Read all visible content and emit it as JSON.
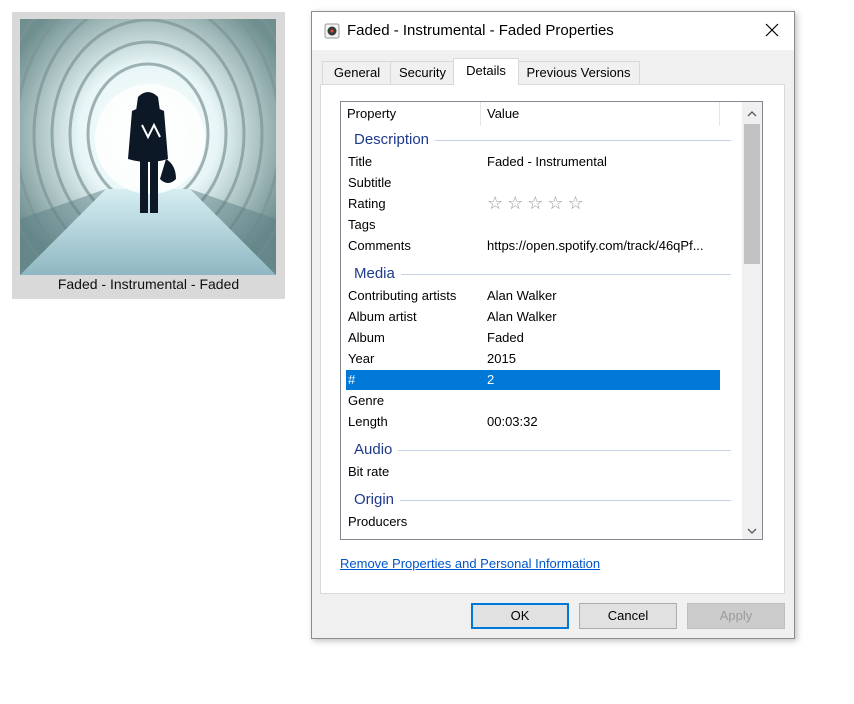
{
  "tile": {
    "label": "Faded - Instrumental - Faded"
  },
  "dialog": {
    "title": "Faded - Instrumental - Faded Properties",
    "tabs": [
      {
        "label": "General"
      },
      {
        "label": "Security"
      },
      {
        "label": "Details"
      },
      {
        "label": "Previous Versions"
      }
    ],
    "active_tab": "Details",
    "columns": {
      "property": "Property",
      "value": "Value"
    },
    "groups": {
      "description": "Description",
      "media": "Media",
      "audio": "Audio",
      "origin": "Origin"
    },
    "rows": {
      "title": {
        "prop": "Title",
        "val": "Faded - Instrumental"
      },
      "subtitle": {
        "prop": "Subtitle",
        "val": ""
      },
      "rating": {
        "prop": "Rating",
        "stars": "☆☆☆☆☆",
        "value": 0
      },
      "tags": {
        "prop": "Tags",
        "val": ""
      },
      "comments": {
        "prop": "Comments",
        "val": "https://open.spotify.com/track/46qPf..."
      },
      "contributing_artists": {
        "prop": "Contributing artists",
        "val": "Alan Walker"
      },
      "album_artist": {
        "prop": "Album artist",
        "val": "Alan Walker"
      },
      "album": {
        "prop": "Album",
        "val": "Faded"
      },
      "year": {
        "prop": "Year",
        "val": "2015"
      },
      "track": {
        "prop": "#",
        "val": "2"
      },
      "genre": {
        "prop": "Genre",
        "val": ""
      },
      "length": {
        "prop": "Length",
        "val": "00:03:32"
      },
      "bit_rate": {
        "prop": "Bit rate",
        "val": ""
      },
      "producers": {
        "prop": "Producers",
        "val": ""
      }
    },
    "remove_link": "Remove Properties and Personal Information",
    "buttons": {
      "ok": "OK",
      "cancel": "Cancel",
      "apply": "Apply"
    },
    "colors": {
      "selection": "#0078d7",
      "group_text": "#1e3a8a",
      "link": "#0055cc"
    }
  }
}
